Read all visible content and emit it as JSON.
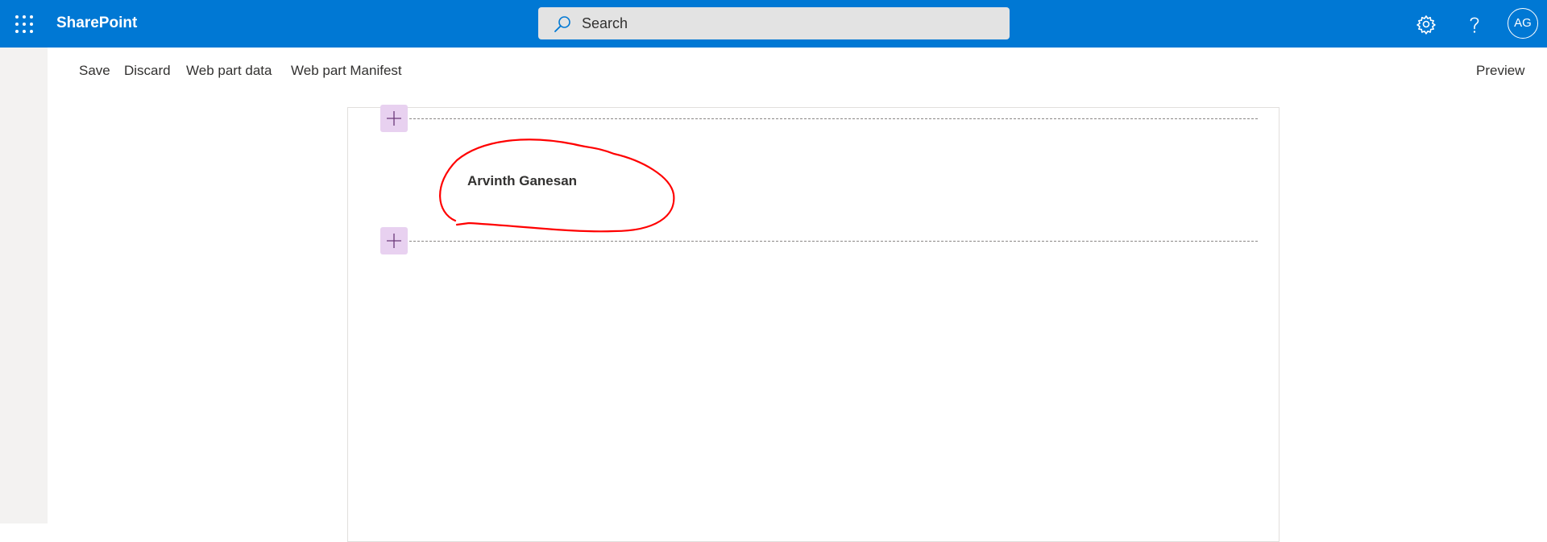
{
  "suitebar": {
    "app_name": "SharePoint",
    "search_placeholder": "Search",
    "avatar_initials": "AG",
    "color": "#0078d4",
    "icons": [
      "app-launcher-icon",
      "search-icon",
      "settings-gear-icon",
      "help-icon"
    ]
  },
  "command_bar": {
    "save_label": "Save",
    "discard_label": "Discard",
    "web_part_data_label": "Web part data",
    "web_part_manifest_label": "Web part Manifest",
    "preview_label": "Preview"
  },
  "canvas": {
    "web_part_text": "Arvinth Ganesan",
    "add_button_color": "#e8d1f0",
    "annotation_color": "#ff0000"
  }
}
